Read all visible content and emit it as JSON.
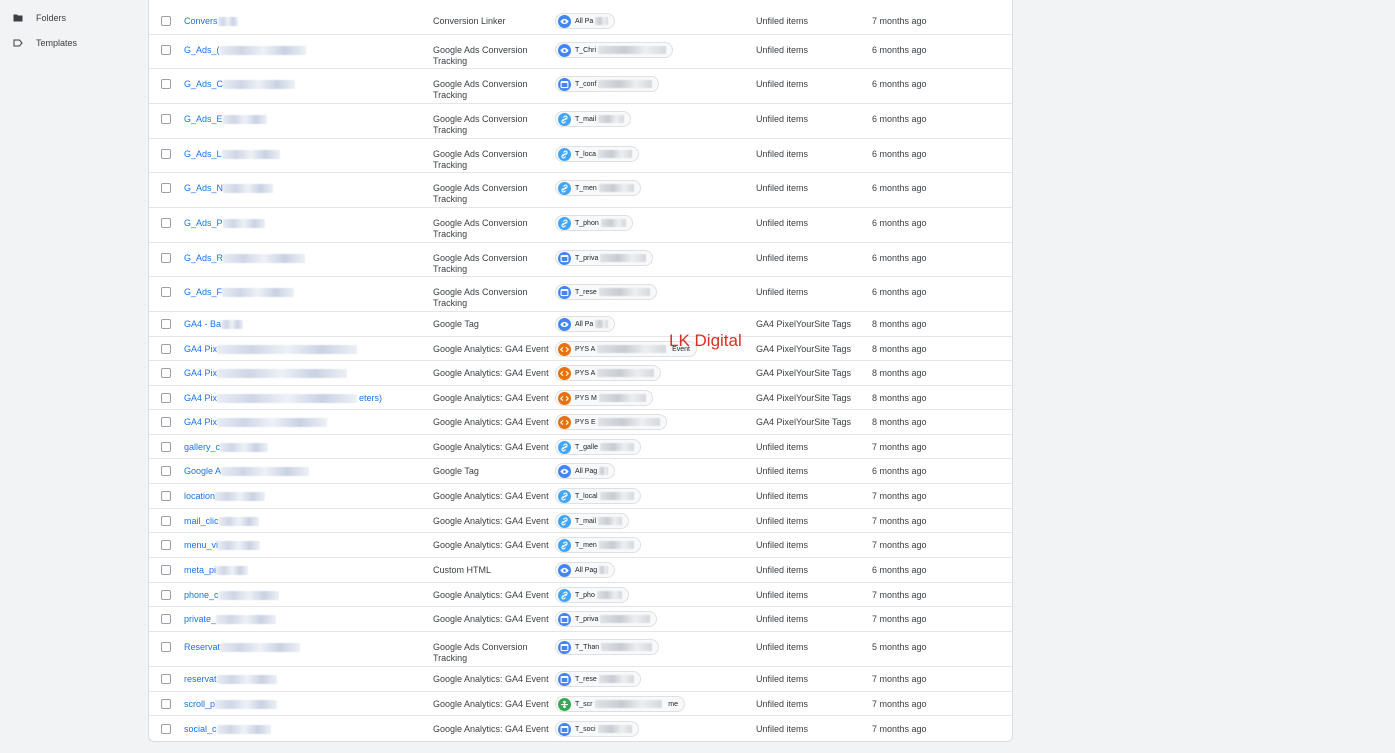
{
  "sidebar": {
    "items": [
      {
        "label": "Folders",
        "icon": "folder-icon"
      },
      {
        "label": "Templates",
        "icon": "template-icon"
      }
    ]
  },
  "colors": {
    "link": "#1a73e8",
    "trigger_blue": "#4285f4",
    "trigger_light_blue": "#42a5f5",
    "trigger_orange": "#e8710a",
    "trigger_green": "#34a853",
    "watermark": "#d93025"
  },
  "watermark": "LK Digital",
  "tags": [
    {
      "name": "Convers",
      "type": "Conversion Linker",
      "trigger": "All Pa",
      "trigger_icon": "eye-icon",
      "trigger_color": "blue",
      "folder": "Unfiled items",
      "updated": "7 months ago"
    },
    {
      "name": "G_Ads_(",
      "type": "Google Ads Conversion Tracking",
      "trigger": "T_Chri",
      "trigger_icon": "eye-icon",
      "trigger_color": "blue",
      "folder": "Unfiled items",
      "updated": "6 months ago"
    },
    {
      "name": "G_Ads_C",
      "type": "Google Ads Conversion Tracking",
      "trigger": "T_conf",
      "trigger_icon": "window-icon",
      "trigger_color": "blue",
      "folder": "Unfiled items",
      "updated": "6 months ago"
    },
    {
      "name": "G_Ads_E",
      "type": "Google Ads Conversion Tracking",
      "trigger": "T_mail",
      "trigger_icon": "link-icon",
      "trigger_color": "lightblue",
      "folder": "Unfiled items",
      "updated": "6 months ago"
    },
    {
      "name": "G_Ads_L",
      "type": "Google Ads Conversion Tracking",
      "trigger": "T_loca",
      "trigger_icon": "link-icon",
      "trigger_color": "lightblue",
      "folder": "Unfiled items",
      "updated": "6 months ago"
    },
    {
      "name": "G_Ads_N",
      "type": "Google Ads Conversion Tracking",
      "trigger": "T_men",
      "trigger_icon": "link-icon",
      "trigger_color": "lightblue",
      "folder": "Unfiled items",
      "updated": "6 months ago"
    },
    {
      "name": "G_Ads_P",
      "type": "Google Ads Conversion Tracking",
      "trigger": "T_phon",
      "trigger_icon": "link-icon",
      "trigger_color": "lightblue",
      "folder": "Unfiled items",
      "updated": "6 months ago"
    },
    {
      "name": "G_Ads_R",
      "type": "Google Ads Conversion Tracking",
      "trigger": "T_priva",
      "trigger_icon": "window-icon",
      "trigger_color": "blue",
      "folder": "Unfiled items",
      "updated": "6 months ago"
    },
    {
      "name": "G_Ads_F",
      "type": "Google Ads Conversion Tracking",
      "trigger": "T_rese",
      "trigger_icon": "window-icon",
      "trigger_color": "blue",
      "folder": "Unfiled items",
      "updated": "6 months ago"
    },
    {
      "name": "GA4 - Ba",
      "type": "Google Tag",
      "trigger": "All Pa",
      "trigger_icon": "eye-icon",
      "trigger_color": "blue",
      "folder": "GA4 PixelYourSite Tags",
      "updated": "8 months ago"
    },
    {
      "name": "GA4 Pix",
      "type": "Google Analytics: GA4 Event",
      "trigger": "PYS A",
      "trigger_suffix": "Event",
      "trigger_icon": "code-icon",
      "trigger_color": "orange",
      "folder": "GA4 PixelYourSite Tags",
      "updated": "8 months ago"
    },
    {
      "name": "GA4 Pix",
      "type": "Google Analytics: GA4 Event",
      "trigger": "PYS A",
      "trigger_icon": "code-icon",
      "trigger_color": "orange",
      "folder": "GA4 PixelYourSite Tags",
      "updated": "8 months ago"
    },
    {
      "name": "GA4 Pix",
      "name_suffix": "eters)",
      "type": "Google Analytics: GA4 Event",
      "trigger": "PYS M",
      "trigger_icon": "code-icon",
      "trigger_color": "orange",
      "folder": "GA4 PixelYourSite Tags",
      "updated": "8 months ago"
    },
    {
      "name": "GA4 Pix",
      "type": "Google Analytics: GA4 Event",
      "trigger": "PYS E",
      "trigger_icon": "code-icon",
      "trigger_color": "orange",
      "folder": "GA4 PixelYourSite Tags",
      "updated": "8 months ago"
    },
    {
      "name": "gallery_c",
      "type": "Google Analytics: GA4 Event",
      "trigger": "T_galle",
      "trigger_icon": "link-icon",
      "trigger_color": "lightblue",
      "folder": "Unfiled items",
      "updated": "7 months ago"
    },
    {
      "name": "Google A",
      "type": "Google Tag",
      "trigger": "All Pag",
      "trigger_icon": "eye-icon",
      "trigger_color": "blue",
      "folder": "Unfiled items",
      "updated": "6 months ago"
    },
    {
      "name": "location",
      "type": "Google Analytics: GA4 Event",
      "trigger": "T_local",
      "trigger_icon": "link-icon",
      "trigger_color": "lightblue",
      "folder": "Unfiled items",
      "updated": "7 months ago"
    },
    {
      "name": "mail_clic",
      "type": "Google Analytics: GA4 Event",
      "trigger": "T_mail",
      "trigger_icon": "link-icon",
      "trigger_color": "lightblue",
      "folder": "Unfiled items",
      "updated": "7 months ago"
    },
    {
      "name": "menu_vi",
      "type": "Google Analytics: GA4 Event",
      "trigger": "T_men",
      "trigger_icon": "link-icon",
      "trigger_color": "lightblue",
      "folder": "Unfiled items",
      "updated": "7 months ago"
    },
    {
      "name": "meta_pi",
      "type": "Custom HTML",
      "trigger": "All Pag",
      "trigger_icon": "eye-icon",
      "trigger_color": "blue",
      "folder": "Unfiled items",
      "updated": "6 months ago"
    },
    {
      "name": "phone_c",
      "type": "Google Analytics: GA4 Event",
      "trigger": "T_pho",
      "trigger_icon": "link-icon",
      "trigger_color": "lightblue",
      "folder": "Unfiled items",
      "updated": "7 months ago"
    },
    {
      "name": "private_",
      "type": "Google Analytics: GA4 Event",
      "trigger": "T_priva",
      "trigger_icon": "window-icon",
      "trigger_color": "blue",
      "folder": "Unfiled items",
      "updated": "7 months ago"
    },
    {
      "name": "Reservat",
      "type": "Google Ads Conversion Tracking",
      "trigger": "T_Than",
      "trigger_icon": "window-icon",
      "trigger_color": "blue",
      "folder": "Unfiled items",
      "updated": "5 months ago"
    },
    {
      "name": "reservat",
      "type": "Google Analytics: GA4 Event",
      "trigger": "T_rese",
      "trigger_icon": "window-icon",
      "trigger_color": "blue",
      "folder": "Unfiled items",
      "updated": "7 months ago"
    },
    {
      "name": "scroll_p",
      "type": "Google Analytics: GA4 Event",
      "trigger": "T_scr",
      "trigger_suffix": "me",
      "trigger_icon": "scroll-icon",
      "trigger_color": "green",
      "folder": "Unfiled items",
      "updated": "7 months ago"
    },
    {
      "name": "social_c",
      "type": "Google Analytics: GA4 Event",
      "trigger": "T_soci",
      "trigger_icon": "window-icon",
      "trigger_color": "blue",
      "folder": "Unfiled items",
      "updated": "7 months ago"
    }
  ]
}
